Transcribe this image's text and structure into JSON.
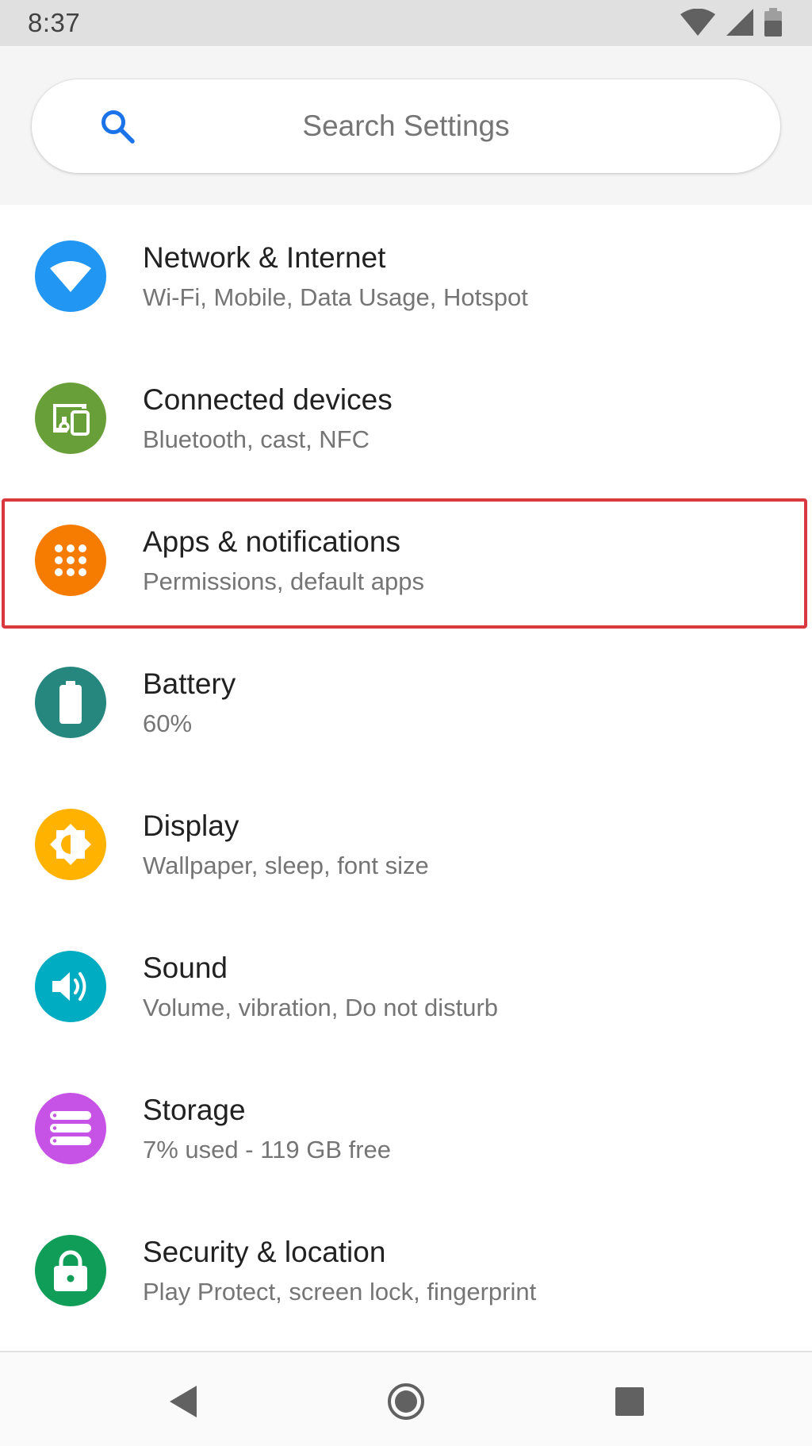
{
  "status_bar": {
    "time": "8:37"
  },
  "search": {
    "placeholder": "Search Settings"
  },
  "settings": [
    {
      "title": "Network & Internet",
      "subtitle": "Wi-Fi, Mobile, Data Usage, Hotspot",
      "icon": "wifi-icon",
      "color": "#2196f3"
    },
    {
      "title": "Connected devices",
      "subtitle": "Bluetooth, cast, NFC",
      "icon": "devices-icon",
      "color": "#689f38"
    },
    {
      "title": "Apps & notifications",
      "subtitle": "Permissions, default apps",
      "icon": "apps-grid-icon",
      "color": "#f57c00"
    },
    {
      "title": "Battery",
      "subtitle": "60%",
      "icon": "battery-icon",
      "color": "#26877f"
    },
    {
      "title": "Display",
      "subtitle": "Wallpaper, sleep, font size",
      "icon": "brightness-icon",
      "color": "#ffb300"
    },
    {
      "title": "Sound",
      "subtitle": "Volume, vibration, Do not disturb",
      "icon": "volume-icon",
      "color": "#00acc1"
    },
    {
      "title": "Storage",
      "subtitle": "7% used - 119 GB free",
      "icon": "storage-icon",
      "color": "#c653e6"
    },
    {
      "title": "Security & location",
      "subtitle": "Play Protect, screen lock, fingerprint",
      "icon": "lock-icon",
      "color": "#0f9d58"
    }
  ],
  "highlight": {
    "color": "#d9383f"
  }
}
